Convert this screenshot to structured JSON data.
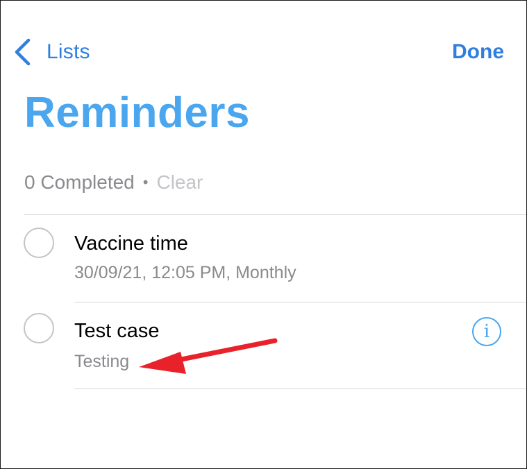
{
  "nav": {
    "back_label": "Lists",
    "done_label": "Done"
  },
  "page": {
    "title": "Reminders"
  },
  "completed": {
    "count_text": "0 Completed",
    "separator": "•",
    "clear_label": "Clear"
  },
  "reminders": [
    {
      "title": "Vaccine time",
      "subtitle": "30/09/21, 12:05 PM, Monthly",
      "completed": false,
      "show_info": false
    },
    {
      "title": "Test case",
      "subtitle": "Testing",
      "completed": false,
      "show_info": true,
      "info_glyph": "i"
    }
  ],
  "icons": {
    "back": "chevron-left-icon",
    "info": "info-circle-icon",
    "annotation": "red-arrow-annotation"
  },
  "colors": {
    "accent": "#2f7fe0",
    "title": "#4aa6ee",
    "secondary_text": "#8a8a8e",
    "disabled_text": "#c4c4c8",
    "annotation": "#e8212a"
  }
}
